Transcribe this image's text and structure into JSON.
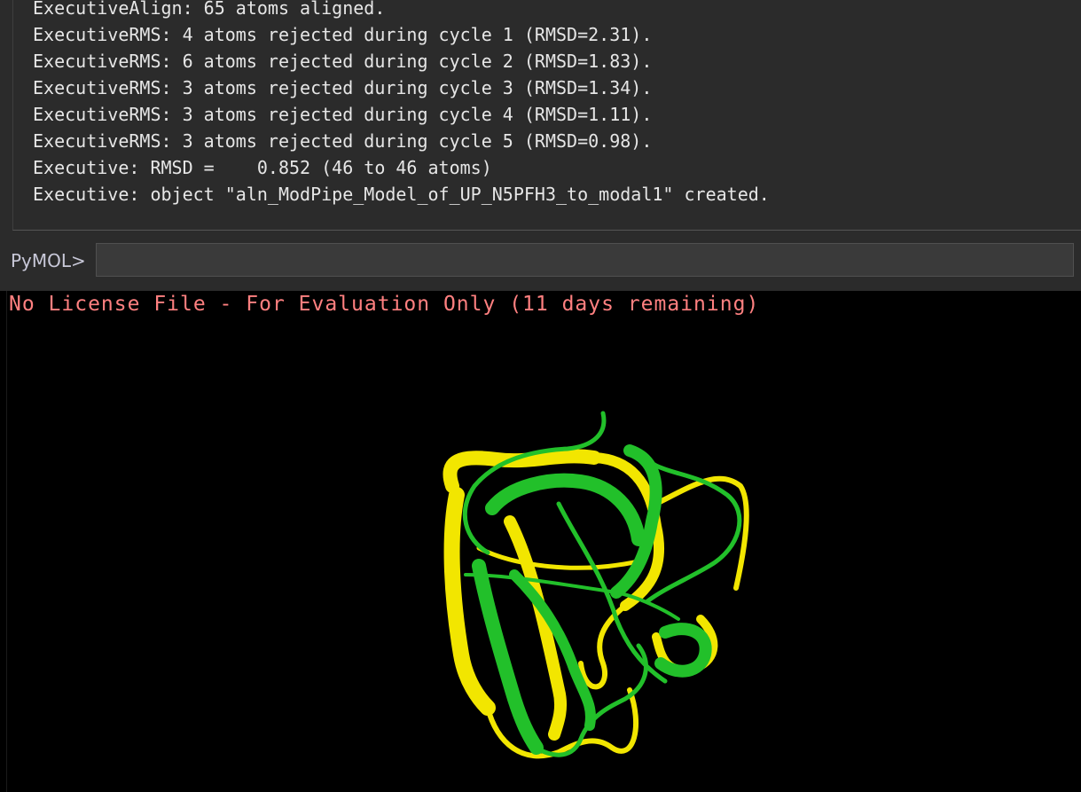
{
  "console": {
    "lines": [
      "ExecutiveAlign: 65 atoms aligned.",
      "ExecutiveRMS: 4 atoms rejected during cycle 1 (RMSD=2.31).",
      "ExecutiveRMS: 6 atoms rejected during cycle 2 (RMSD=1.83).",
      "ExecutiveRMS: 3 atoms rejected during cycle 3 (RMSD=1.34).",
      "ExecutiveRMS: 3 atoms rejected during cycle 4 (RMSD=1.11).",
      "ExecutiveRMS: 3 atoms rejected during cycle 5 (RMSD=0.98).",
      "Executive: RMSD =    0.852 (46 to 46 atoms)",
      "Executive: object \"aln_ModPipe_Model_of_UP_N5PFH3_to_modal1\" created."
    ]
  },
  "command": {
    "prompt": "PyMOL>",
    "value": ""
  },
  "viewer": {
    "license_text": "No License File - For Evaluation Only (11 days remaining)",
    "colors": {
      "structure_a": "#f2e600",
      "structure_b": "#22c02a"
    }
  }
}
